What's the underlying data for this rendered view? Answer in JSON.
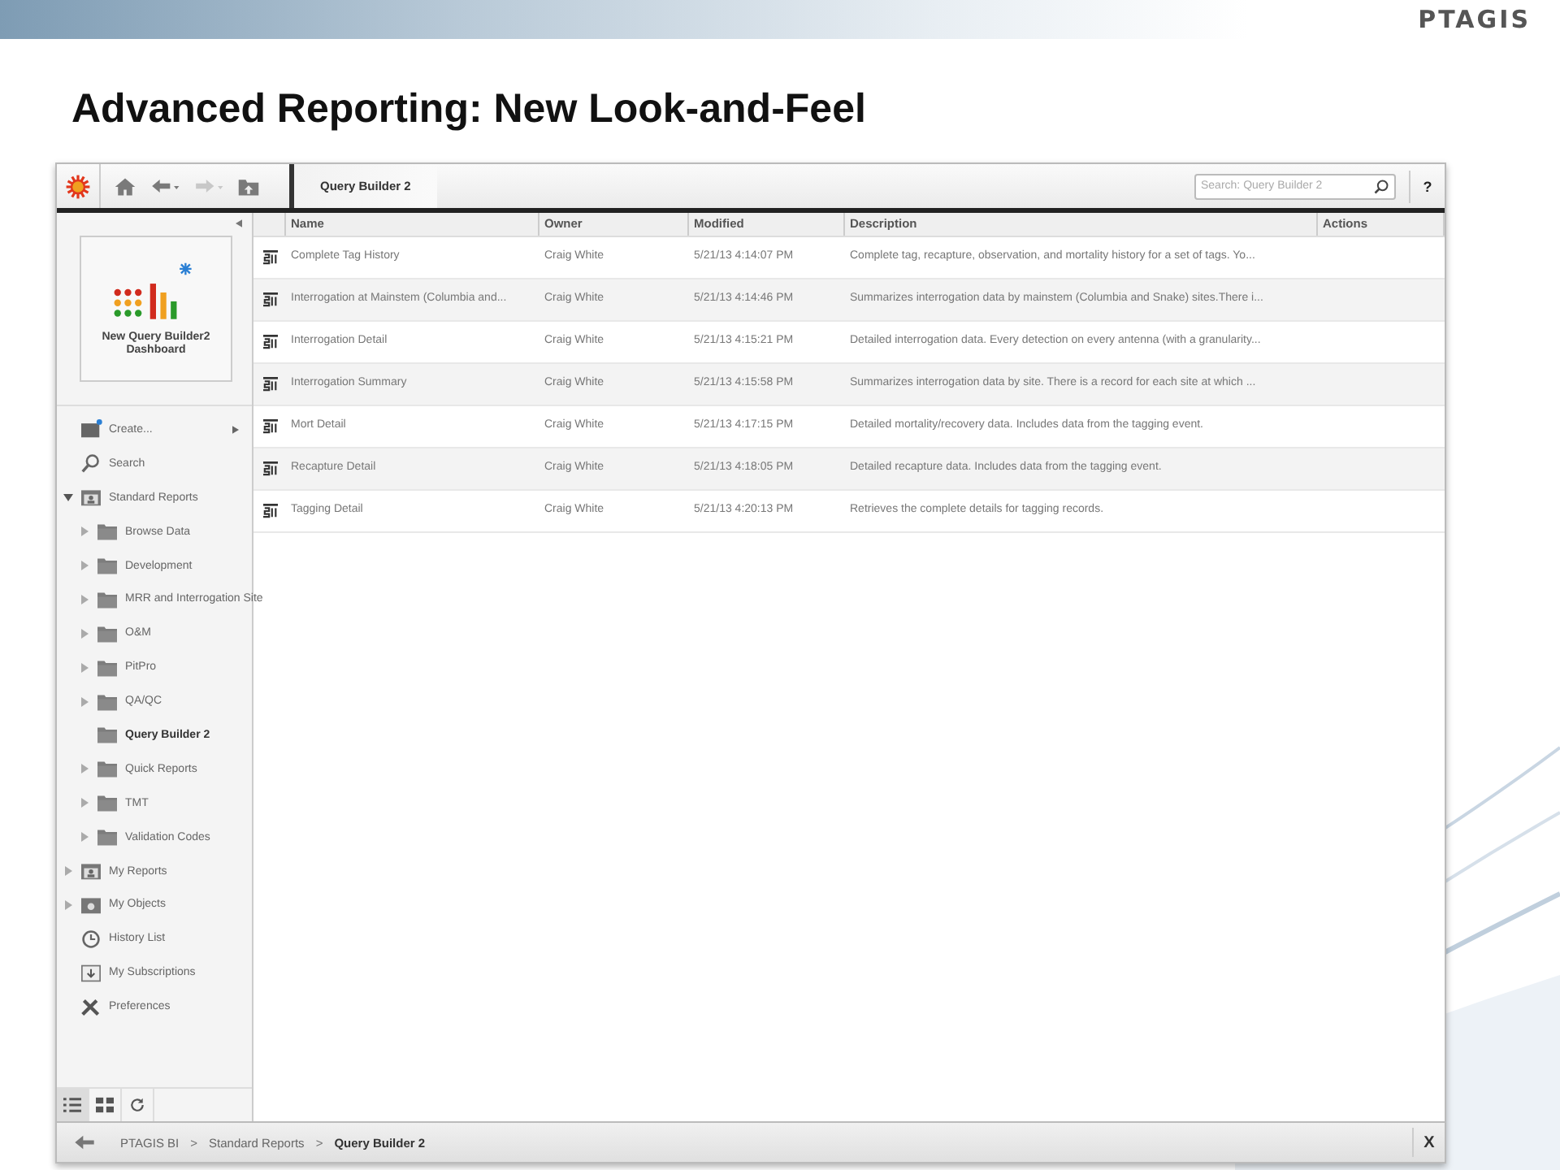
{
  "slide": {
    "title": "Advanced Reporting: New Look-and-Feel",
    "logo": "PTAGIS"
  },
  "toolbar": {
    "forward_disabled": true,
    "breadcrumb": "Query Builder 2",
    "search": {
      "placeholder": "Search: Query Builder 2"
    },
    "help": "?"
  },
  "sidebar": {
    "tile": {
      "label": "New Query Builder2 Dashboard"
    },
    "items": [
      {
        "kind": "create",
        "label": "Create...",
        "selected": false
      },
      {
        "kind": "search",
        "label": "Search",
        "selected": false
      },
      {
        "kind": "shared",
        "label": "Standard Reports",
        "expanded": true,
        "selected": false,
        "children": [
          {
            "kind": "folder",
            "label": "Browse Data",
            "expanded": false,
            "selected": false
          },
          {
            "kind": "folder",
            "label": "Development",
            "expanded": false,
            "selected": false
          },
          {
            "kind": "folder",
            "label": "MRR and Interrogation Site",
            "expanded": false,
            "selected": false
          },
          {
            "kind": "folder",
            "label": "O&M",
            "expanded": false,
            "selected": false
          },
          {
            "kind": "folder",
            "label": "PitPro",
            "expanded": false,
            "selected": false
          },
          {
            "kind": "folder",
            "label": "QA/QC",
            "expanded": false,
            "selected": false
          },
          {
            "kind": "folder",
            "label": "Query Builder 2",
            "selected": true
          },
          {
            "kind": "folder",
            "label": "Quick Reports",
            "expanded": false,
            "selected": false
          },
          {
            "kind": "folder",
            "label": "TMT",
            "expanded": false,
            "selected": false
          },
          {
            "kind": "folder",
            "label": "Validation Codes",
            "expanded": false,
            "selected": false
          }
        ]
      },
      {
        "kind": "personal",
        "label": "My Reports",
        "expanded": false,
        "selected": false
      },
      {
        "kind": "objects",
        "label": "My Objects",
        "expanded": false,
        "selected": false
      },
      {
        "kind": "history",
        "label": "History List",
        "selected": false
      },
      {
        "kind": "subscriptions",
        "label": "My Subscriptions",
        "selected": false
      },
      {
        "kind": "preferences",
        "label": "Preferences",
        "selected": false
      }
    ]
  },
  "table": {
    "columns": [
      "Name",
      "Owner",
      "Modified",
      "Description",
      "Actions"
    ],
    "rows": [
      {
        "name": "Complete Tag History",
        "owner": "Craig White",
        "modified": "5/21/13 4:14:07 PM",
        "description": "Complete tag, recapture, observation, and mortality history for a set of tags. Yo..."
      },
      {
        "name": "Interrogation at Mainstem (Columbia and...",
        "owner": "Craig White",
        "modified": "5/21/13 4:14:46 PM",
        "description": "Summarizes interrogation data by mainstem (Columbia and Snake) sites.There i..."
      },
      {
        "name": "Interrogation Detail",
        "owner": "Craig White",
        "modified": "5/21/13 4:15:21 PM",
        "description": "Detailed interrogation data. Every detection on every antenna (with a granularity..."
      },
      {
        "name": "Interrogation Summary",
        "owner": "Craig White",
        "modified": "5/21/13 4:15:58 PM",
        "description": "Summarizes interrogation data by site. There is a record for each site at which ..."
      },
      {
        "name": "Mort Detail",
        "owner": "Craig White",
        "modified": "5/21/13 4:17:15 PM",
        "description": "Detailed mortality/recovery data. Includes data from the tagging event."
      },
      {
        "name": "Recapture Detail",
        "owner": "Craig White",
        "modified": "5/21/13 4:18:05 PM",
        "description": "Detailed recapture data. Includes data from the tagging event."
      },
      {
        "name": "Tagging Detail",
        "owner": "Craig White",
        "modified": "5/21/13 4:20:13 PM",
        "description": "Retrieves the complete details for tagging records."
      }
    ]
  },
  "view_tabs": [
    {
      "kind": "list",
      "selected": true
    },
    {
      "kind": "tiles",
      "selected": false
    },
    {
      "kind": "refresh",
      "selected": false
    }
  ],
  "status_bar": {
    "path": [
      {
        "text": "PTAGIS BI",
        "selected": false
      },
      {
        "text": "Standard Reports",
        "selected": false
      },
      {
        "text": "Query Builder 2",
        "selected": true
      }
    ],
    "separators": [
      ">",
      ">"
    ],
    "close": "X"
  }
}
